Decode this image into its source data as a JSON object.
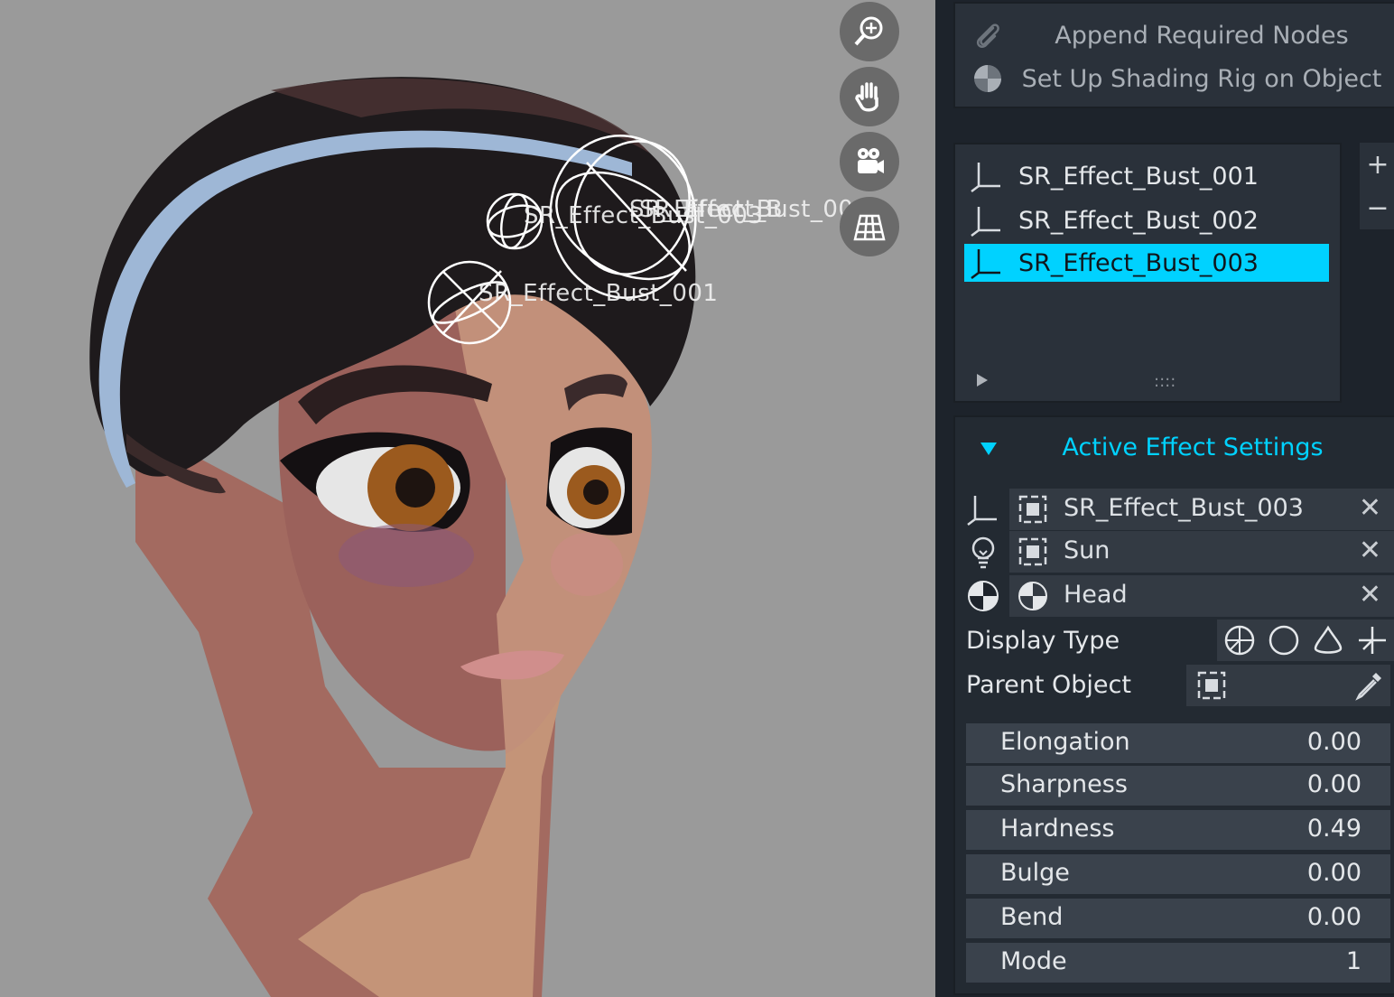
{
  "viewport": {
    "labels": [
      "SR_Effect_Bust_001",
      "SR_Effect_Bust_002",
      "SR_Effect_Bust_003",
      "SR_Effect_Bust_003"
    ],
    "nav_icons": [
      "zoom-in-icon",
      "hand-pan-icon",
      "camera-icon",
      "grid-perspective-icon"
    ]
  },
  "panel": {
    "operators": {
      "append": "Append Required Nodes",
      "setup": "Set Up Shading Rig on Object"
    },
    "effects_list": [
      {
        "label": "SR_Effect_Bust_001"
      },
      {
        "label": "SR_Effect_Bust_002"
      },
      {
        "label": "SR_Effect_Bust_003",
        "active": true
      }
    ],
    "list_grip": "::::",
    "add_symbol": "+",
    "remove_symbol": "−",
    "settings": {
      "title": "Active Effect Settings",
      "effect_object": "SR_Effect_Bust_003",
      "light_object": "Sun",
      "mesh_object": "Head",
      "close_symbol": "✕",
      "display_type_label": "Display Type",
      "parent_object_label": "Parent Object",
      "properties": [
        {
          "name": "Elongation",
          "value": "0.00"
        },
        {
          "name": "Sharpness",
          "value": "0.00"
        },
        {
          "name": "Hardness",
          "value": "0.49"
        },
        {
          "name": "Bulge",
          "value": "0.00"
        },
        {
          "name": "Bend",
          "value": "0.00"
        },
        {
          "name": "Mode",
          "value": "1"
        }
      ]
    }
  },
  "colors": {
    "accent": "#00d2ff",
    "panel_bg": "#1d232b",
    "viewport_bg": "#9a9a9a"
  }
}
